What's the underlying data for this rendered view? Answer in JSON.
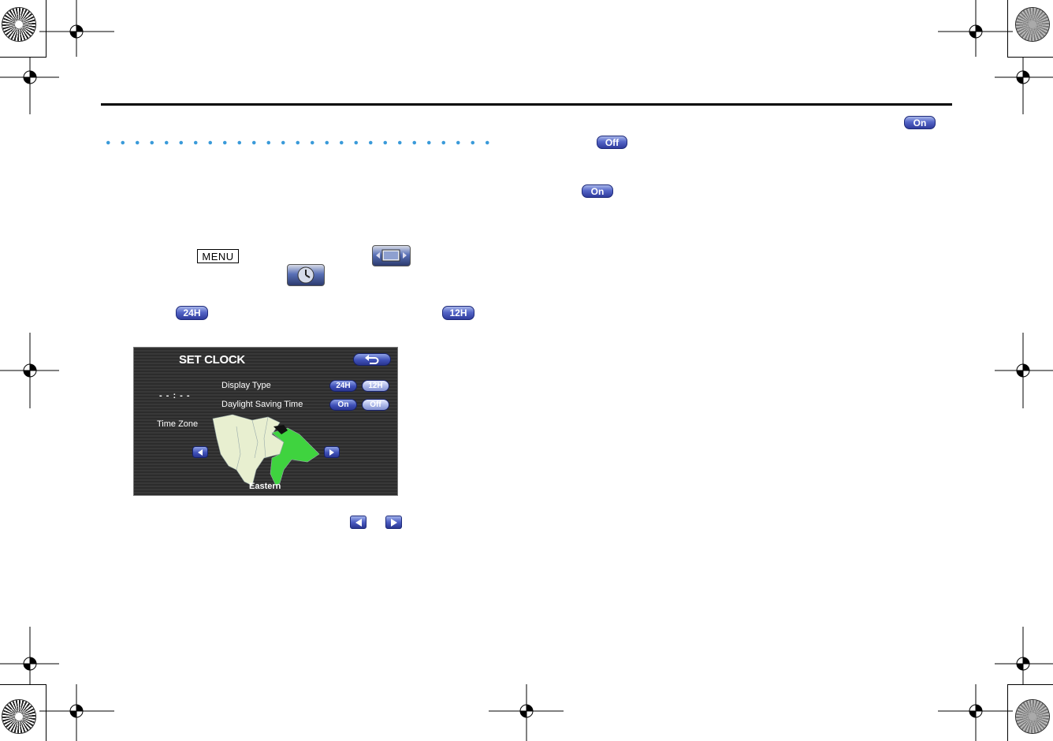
{
  "instructions": {
    "menu_key": "MENU",
    "btn_24h": "24H",
    "btn_12h": "12H"
  },
  "dst_buttons": {
    "on_label": "On",
    "off_label": "Off"
  },
  "screen": {
    "title": "SET CLOCK",
    "time_display": "- - : - -",
    "display_type_label": "Display Type",
    "dst_label": "Daylight Saving Time",
    "time_zone_label": "Time Zone",
    "btn_24h": "24H",
    "btn_12h": "12H",
    "btn_on": "On",
    "btn_off": "Off",
    "zone_name": "Eastern"
  },
  "icons": [
    "back-arrow-icon",
    "left-arrow-icon",
    "right-arrow-icon",
    "settings-icon",
    "clock-icon"
  ],
  "colors": {
    "accent": "#3f51b9",
    "dots": "#3a9ad9",
    "map_land": "#e8efd0",
    "map_highlight": "#3fd33f"
  }
}
